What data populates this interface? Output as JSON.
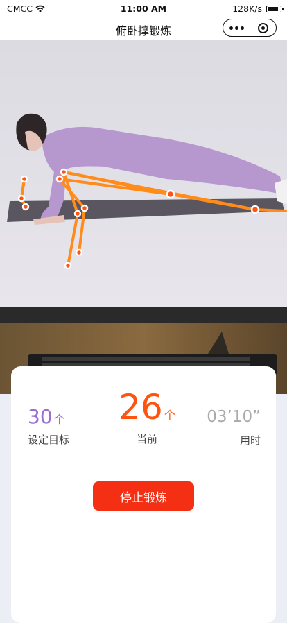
{
  "status_bar": {
    "carrier": "CMCC",
    "time": "11:00 AM",
    "network_speed": "128K/s"
  },
  "nav": {
    "title": "俯卧撑锻炼"
  },
  "stats": {
    "goal": {
      "value": "30",
      "unit": "个",
      "label": "设定目标"
    },
    "current": {
      "value": "26",
      "unit": "个",
      "label": "当前"
    },
    "elapsed": {
      "value": "03’10”",
      "label": "用时"
    }
  },
  "actions": {
    "stop_label": "停止锻炼"
  },
  "colors": {
    "accent": "#ff5410",
    "stop_button": "#f42f14",
    "goal": "#9b6dd0",
    "skeleton": "#ff8c1a"
  }
}
